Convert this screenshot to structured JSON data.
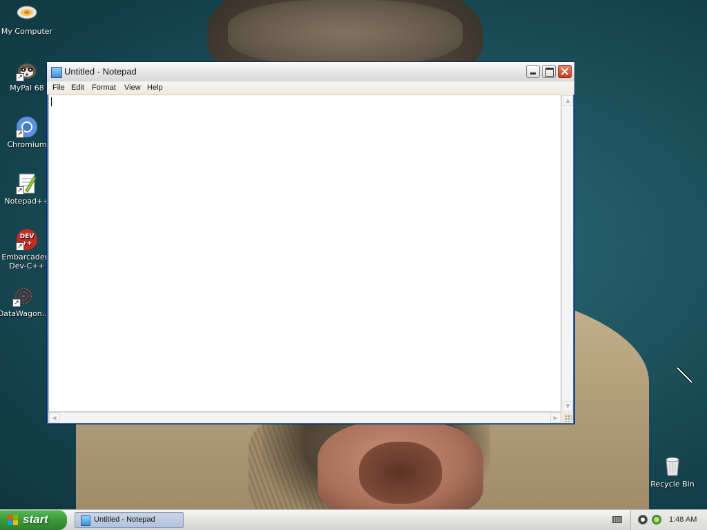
{
  "desktop": {
    "icons": [
      {
        "label": "My Computer",
        "icon": "my-computer-icon"
      },
      {
        "label": "MyPal 68",
        "icon": "mypal-icon"
      },
      {
        "label": "Chromium",
        "icon": "chromium-icon"
      },
      {
        "label": "Notepad++",
        "icon": "notepad-plus-plus-icon"
      },
      {
        "label": "Embarcadero Dev-C++",
        "line1": "Embarcadero",
        "line2": "Dev-C++",
        "icon": "dev-cpp-icon",
        "icon_text": "DEV"
      },
      {
        "label": "DataWagon...",
        "icon": "datawagon-icon"
      },
      {
        "label": "Recycle Bin",
        "icon": "recycle-bin-icon"
      }
    ]
  },
  "window": {
    "title": "Untitled - Notepad",
    "menu": [
      "File",
      "Edit",
      "Format",
      "View",
      "Help"
    ],
    "content": "",
    "buttons": {
      "minimize": "minimize-icon",
      "maximize": "maximize-icon",
      "close": "close-icon"
    }
  },
  "taskbar": {
    "start_label": "start",
    "tasks": [
      {
        "label": "Untitled - Notepad"
      }
    ],
    "clock": "1:48 AM"
  },
  "colors": {
    "desktop_bg": "#1e5560",
    "start_green": "#3a9a3a",
    "close_red": "#c3401e"
  }
}
